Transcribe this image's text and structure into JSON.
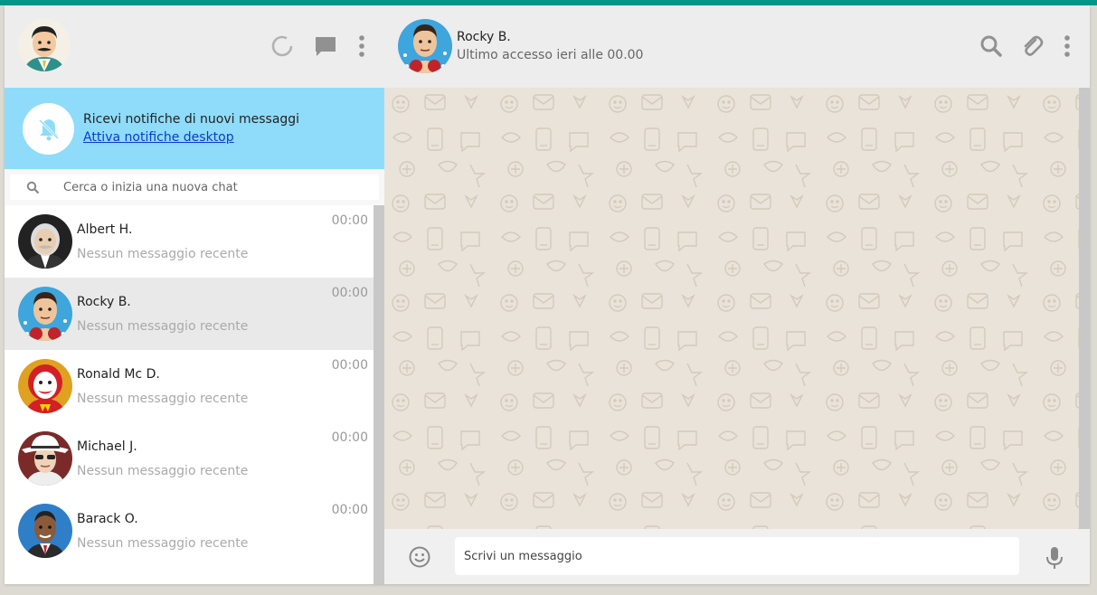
{
  "accent_color": "#009688",
  "notification_color": "#8edcfa",
  "me": {
    "avatar_icon": "avatar-me-icon"
  },
  "left_header": {
    "icons": [
      "status-icon",
      "new-chat-icon",
      "menu-icon"
    ]
  },
  "notification": {
    "title": "Ricevi notifiche di nuovi messaggi",
    "link": "Attiva notifiche desktop",
    "icon": "bell-off-icon"
  },
  "search": {
    "placeholder": "Cerca o inizia una nuova chat",
    "value": ""
  },
  "chats": [
    {
      "name": "Albert H.",
      "last_message": "Nessun messaggio recente",
      "time": "00:00",
      "active": false
    },
    {
      "name": "Rocky B.",
      "last_message": "Nessun messaggio recente",
      "time": "00:00",
      "active": true
    },
    {
      "name": "Ronald Mc D.",
      "last_message": "Nessun messaggio recente",
      "time": "00:00",
      "active": false
    },
    {
      "name": "Michael J.",
      "last_message": "Nessun messaggio recente",
      "time": "00:00",
      "active": false
    },
    {
      "name": "Barack O.",
      "last_message": "Nessun messaggio recente",
      "time": "00:00",
      "active": false
    }
  ],
  "contact": {
    "name": "Rocky B.",
    "status": "Ultimo accesso ieri alle 00.00",
    "icons": [
      "search-icon",
      "attach-icon",
      "menu-icon"
    ]
  },
  "composer": {
    "placeholder": "Scrivi un messaggio",
    "value": ""
  }
}
